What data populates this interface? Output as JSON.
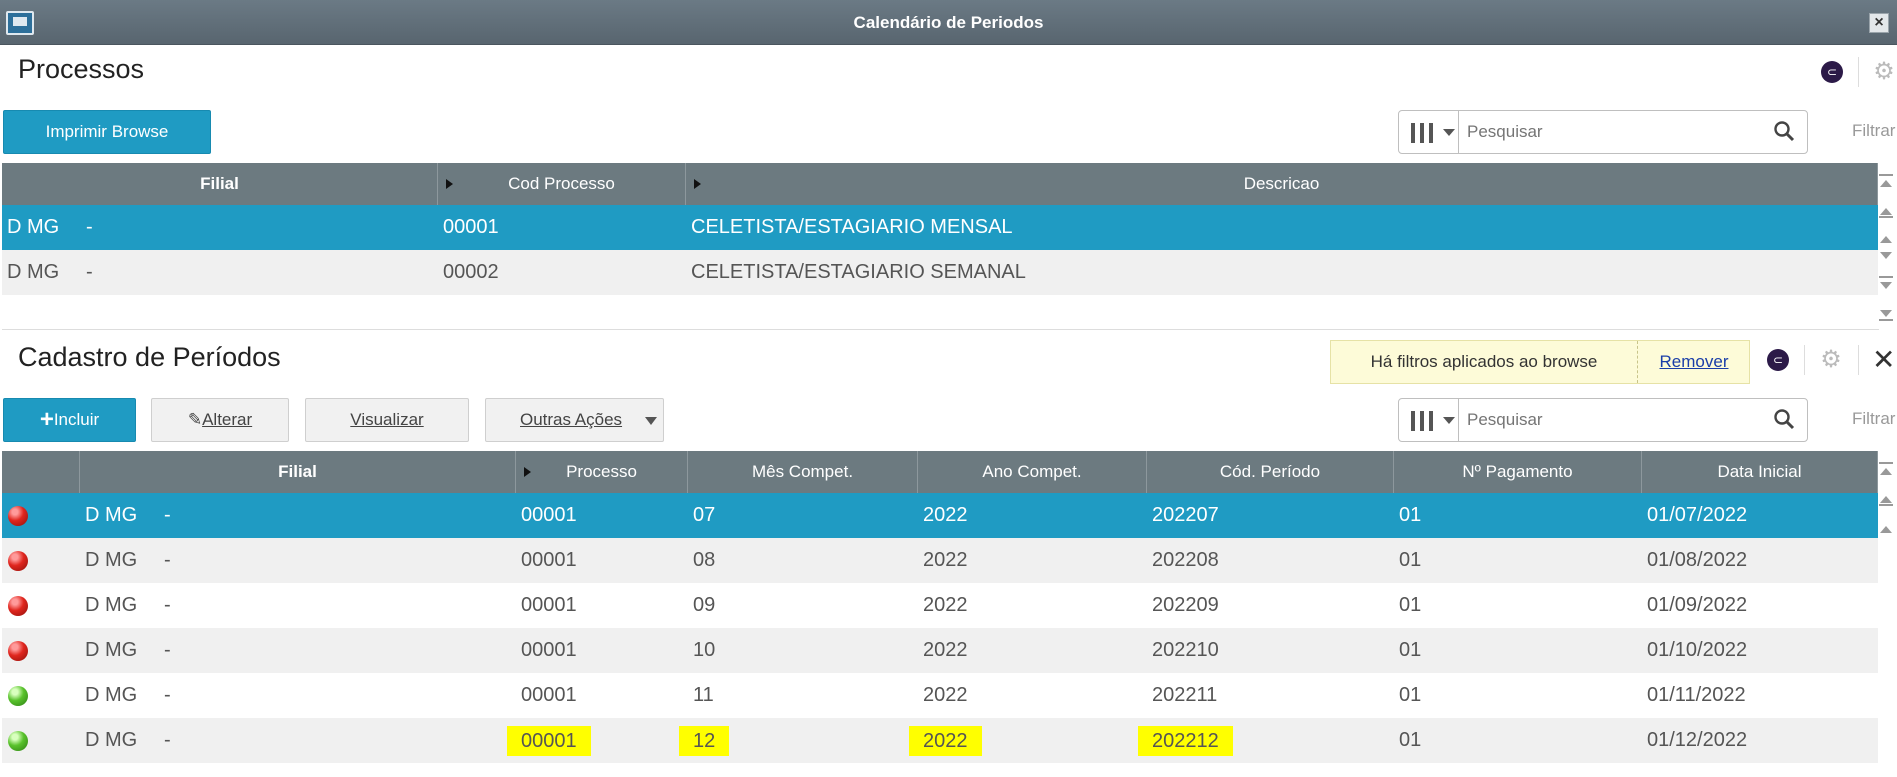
{
  "window": {
    "title": "Calendário de Periodos",
    "close": "×"
  },
  "processos": {
    "title": "Processos",
    "print_button": "Imprimir Browse",
    "search": {
      "placeholder": "Pesquisar"
    },
    "filtrar": "Filtrar",
    "columns": [
      "Filial",
      "Cod Processo",
      "Descricao"
    ],
    "rows": [
      {
        "filial": "D MG",
        "sep": "-",
        "cod": "00001",
        "descricao": "CELETISTA/ESTAGIARIO MENSAL",
        "selected": true
      },
      {
        "filial": "D MG",
        "sep": "-",
        "cod": "00002",
        "descricao": "CELETISTA/ESTAGIARIO SEMANAL",
        "selected": false
      }
    ]
  },
  "cadastro": {
    "title": "Cadastro de Períodos",
    "notice": {
      "text": "Há filtros aplicados ao browse",
      "remove": "Remover"
    },
    "buttons": {
      "incluir": "Incluir",
      "alterar": "Alterar",
      "visualizar": "Visualizar",
      "outras": "Outras Ações"
    },
    "search": {
      "placeholder": "Pesquisar"
    },
    "filtrar": "Filtrar",
    "columns": [
      "Filial",
      "Processo",
      "Mês Compet.",
      "Ano Compet.",
      "Cód. Período",
      "Nº Pagamento",
      "Data Inicial"
    ],
    "rows": [
      {
        "status": "red",
        "filial": "D MG",
        "sep": "-",
        "processo": "00001",
        "mes": "07",
        "ano": "2022",
        "periodo": "202207",
        "pagamento": "01",
        "data": "01/07/2022",
        "selected": true,
        "highlight": false
      },
      {
        "status": "red",
        "filial": "D MG",
        "sep": "-",
        "processo": "00001",
        "mes": "08",
        "ano": "2022",
        "periodo": "202208",
        "pagamento": "01",
        "data": "01/08/2022",
        "selected": false,
        "highlight": false
      },
      {
        "status": "red",
        "filial": "D MG",
        "sep": "-",
        "processo": "00001",
        "mes": "09",
        "ano": "2022",
        "periodo": "202209",
        "pagamento": "01",
        "data": "01/09/2022",
        "selected": false,
        "highlight": false
      },
      {
        "status": "red",
        "filial": "D MG",
        "sep": "-",
        "processo": "00001",
        "mes": "10",
        "ano": "2022",
        "periodo": "202210",
        "pagamento": "01",
        "data": "01/10/2022",
        "selected": false,
        "highlight": false
      },
      {
        "status": "green",
        "filial": "D MG",
        "sep": "-",
        "processo": "00001",
        "mes": "11",
        "ano": "2022",
        "periodo": "202211",
        "pagamento": "01",
        "data": "01/11/2022",
        "selected": false,
        "highlight": false
      },
      {
        "status": "green",
        "filial": "D MG",
        "sep": "-",
        "processo": "00001",
        "mes": "12",
        "ano": "2022",
        "periodo": "202212",
        "pagamento": "01",
        "data": "01/12/2022",
        "selected": false,
        "highlight": true
      }
    ]
  },
  "colors": {
    "accent": "#1f9bc3",
    "header": "#6c7a80",
    "highlight": "#ffff00",
    "status_red": "#e0261e",
    "status_green": "#59c22c"
  }
}
